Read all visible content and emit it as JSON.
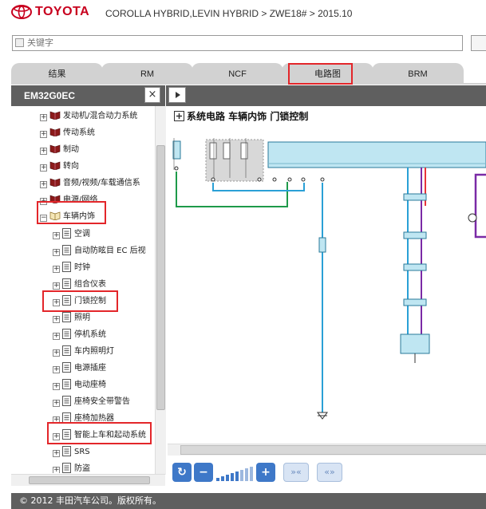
{
  "header": {
    "brand": "TOYOTA",
    "breadcrumb": "COROLLA HYBRID,LEVIN HYBRID > ZWE18# > 2015.10"
  },
  "search": {
    "placeholder": "关键字"
  },
  "tabs": [
    {
      "label": "结果"
    },
    {
      "label": "RM"
    },
    {
      "label": "NCF"
    },
    {
      "label": "电路图",
      "selected": true
    },
    {
      "label": "BRM"
    }
  ],
  "panel": {
    "code": "EM32G0EC",
    "close_label": "×"
  },
  "tree": {
    "categories": [
      {
        "label": "发动机/混合动力系统",
        "expander": "+"
      },
      {
        "label": "传动系统",
        "expander": "+"
      },
      {
        "label": "制动",
        "expander": "+"
      },
      {
        "label": "转向",
        "expander": "+"
      },
      {
        "label": "音频/视频/车载通信系",
        "expander": "+"
      },
      {
        "label": "电源/网络",
        "expander": "+"
      },
      {
        "label": "车辆内饰",
        "expander": "−",
        "expanded": true
      }
    ],
    "children": [
      {
        "label": "空调"
      },
      {
        "label": "自动防眩目 EC 后视"
      },
      {
        "label": "时钟"
      },
      {
        "label": "组合仪表"
      },
      {
        "label": "门锁控制",
        "selected": true
      },
      {
        "label": "照明"
      },
      {
        "label": "停机系统"
      },
      {
        "label": "车内照明灯"
      },
      {
        "label": "电源插座"
      },
      {
        "label": "电动座椅"
      },
      {
        "label": "座椅安全带警告"
      },
      {
        "label": "座椅加热器"
      },
      {
        "label": "智能上车和起动系统"
      },
      {
        "label": "SRS"
      },
      {
        "label": "防盗"
      }
    ]
  },
  "diagram": {
    "title": "系统电路  车辆内饰  门锁控制",
    "title_icon": "plus-box-icon",
    "wire_colors": {
      "green": "#1e9a4a",
      "blue": "#2aa0d6",
      "red": "#e8343a",
      "purple": "#7a2aa6",
      "module": "#bfe6f2"
    }
  },
  "toolbar": {
    "buttons": [
      "refresh-icon",
      "zoom-out-icon",
      "zoom-in-icon",
      "first-page-icon",
      "previous-page-icon"
    ],
    "zoom_level_steps": 8,
    "zoom_level_current": 5
  },
  "footer": {
    "copyright": "© 2012 丰田汽车公司。版权所有。"
  }
}
